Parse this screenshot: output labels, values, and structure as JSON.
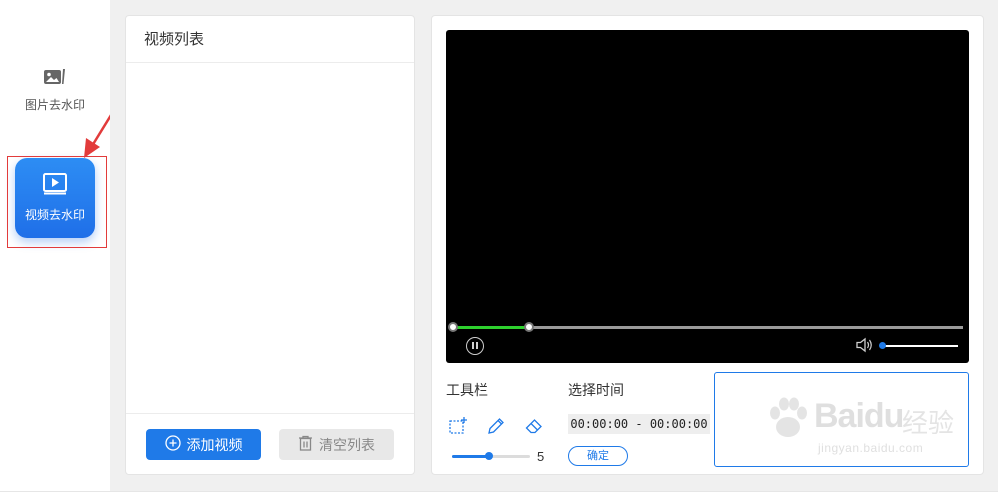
{
  "sidebar": {
    "items": [
      {
        "label": "图片去水印",
        "icon": "image-icon",
        "active": false
      },
      {
        "label": "视频去水印",
        "icon": "video-play-icon",
        "active": true
      }
    ]
  },
  "video_list": {
    "title": "视频列表",
    "add_label": "添加视频",
    "clear_label": "清空列表"
  },
  "player": {
    "progress": 0.15,
    "volume": 0.0,
    "playing": true
  },
  "toolbar": {
    "title": "工具栏",
    "tools": [
      "select-rect-icon",
      "pen-icon",
      "eraser-icon"
    ],
    "brush_size": "5",
    "brush_level": 0.47
  },
  "time_select": {
    "title": "选择时间",
    "range": "00:00:00 - 00:00:00",
    "confirm_label": "确定"
  },
  "watermark": {
    "brand": "Baidu",
    "cn": "经验",
    "url": "jingyan.baidu.com"
  },
  "colors": {
    "accent": "#1f7ae8",
    "progress_green": "#2ed12e",
    "highlight_red": "#e23b3b"
  }
}
